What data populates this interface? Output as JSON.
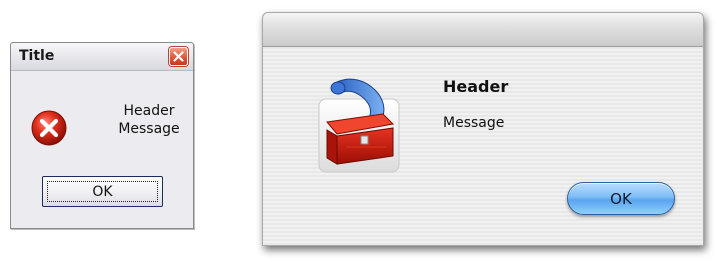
{
  "xp_dialog": {
    "title": "Title",
    "header": "Header",
    "message": "Message",
    "ok_label": "OK",
    "close_icon": "close-icon",
    "error_icon": "error-icon",
    "accent": "#e0583a"
  },
  "mac_dialog": {
    "header": "Header",
    "message": "Message",
    "ok_label": "OK",
    "app_icon": "toolbox-app-icon",
    "accent": "#7fbdf6"
  }
}
